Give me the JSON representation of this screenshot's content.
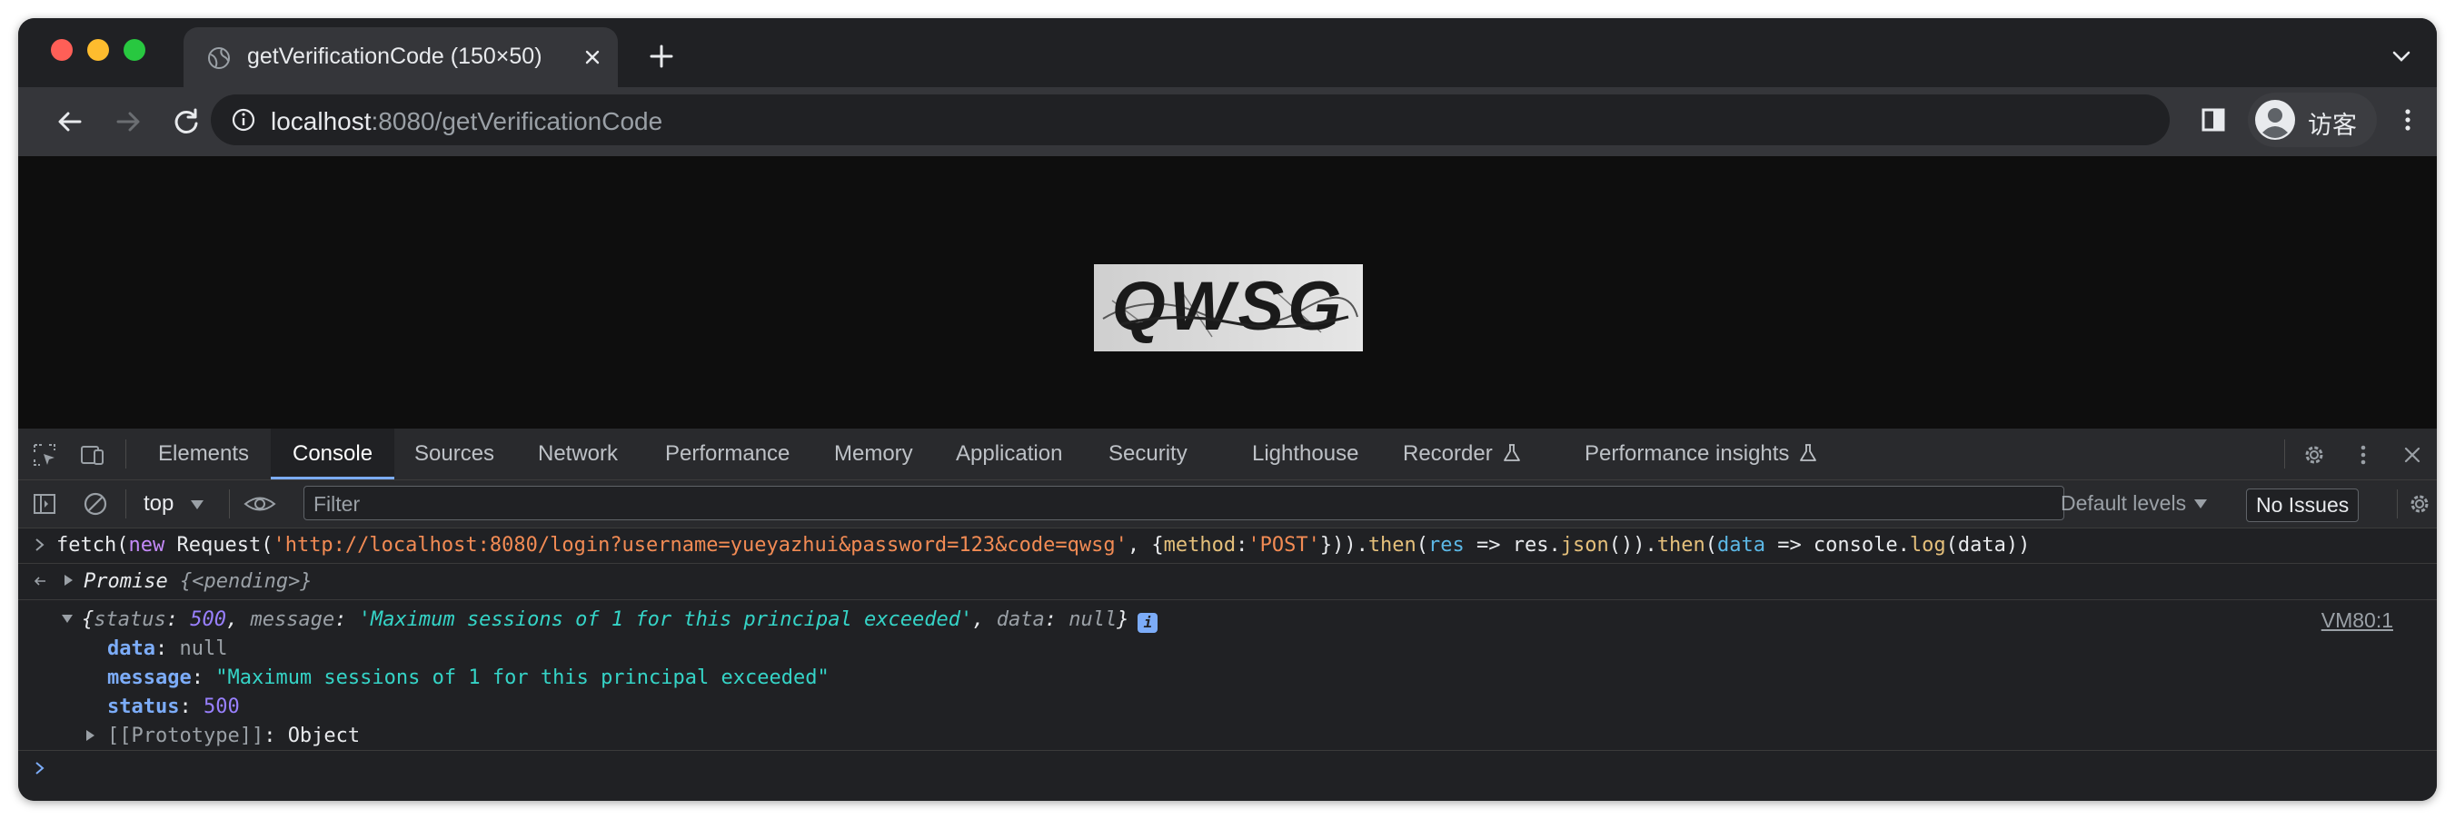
{
  "browser": {
    "tab_title": "getVerificationCode (150×50)",
    "url_host": "localhost",
    "url_rest": ":8080/getVerificationCode",
    "profile_name": "访客"
  },
  "page": {
    "captcha_text": "QWSG"
  },
  "devtools": {
    "tabs": [
      "Elements",
      "Console",
      "Sources",
      "Network",
      "Performance",
      "Memory",
      "Application",
      "Security",
      "Lighthouse",
      "Recorder",
      "Performance insights"
    ],
    "active_tab": "Console",
    "context": "top",
    "filter_placeholder": "Filter",
    "levels": "Default levels",
    "issues": "No Issues"
  },
  "console": {
    "input_fetch": "fetch(",
    "input_new": "new",
    "input_request": " Request(",
    "input_url": "'http://localhost:8080/login?username=yueyazhui&password=123&code=qwsg'",
    "input_comma": ", {",
    "input_method_key": "method",
    "input_colon": ":",
    "input_method_val": "'POST'",
    "input_close": "})).",
    "input_then1": "then",
    "input_paren1": "(",
    "input_res": "res",
    "input_arrow1": " => res.",
    "input_json": "json",
    "input_mid": "()).",
    "input_then2": "then",
    "input_paren2": "(",
    "input_data": "data",
    "input_arrow2": " => console.",
    "input_log": "log",
    "input_end": "(data))",
    "promise_label": "Promise ",
    "promise_value": "{<pending>}",
    "summary_open": "{",
    "summary_status_key": "status",
    "summary_status_val": "500",
    "summary_message_key": "message",
    "summary_message_val": "'Maximum sessions of 1 for this principal exceeded'",
    "summary_data_key": "data",
    "summary_data_val": "null",
    "summary_close": "}",
    "source_link": "VM80:1",
    "prop_data_key": "data",
    "prop_data_val": "null",
    "prop_message_key": "message",
    "prop_message_val": "\"Maximum sessions of 1 for this principal exceeded\"",
    "prop_status_key": "status",
    "prop_status_val": "500",
    "prototype_key": "[[Prototype]]",
    "prototype_val": "Object"
  },
  "colors": {
    "string": "#f28b54",
    "keyword": "#c58af9",
    "function": "#e5c07b",
    "variable": "#5cb8e6",
    "number": "#9980ff",
    "string_value": "#35d4c7",
    "property": "#7cacf8"
  }
}
